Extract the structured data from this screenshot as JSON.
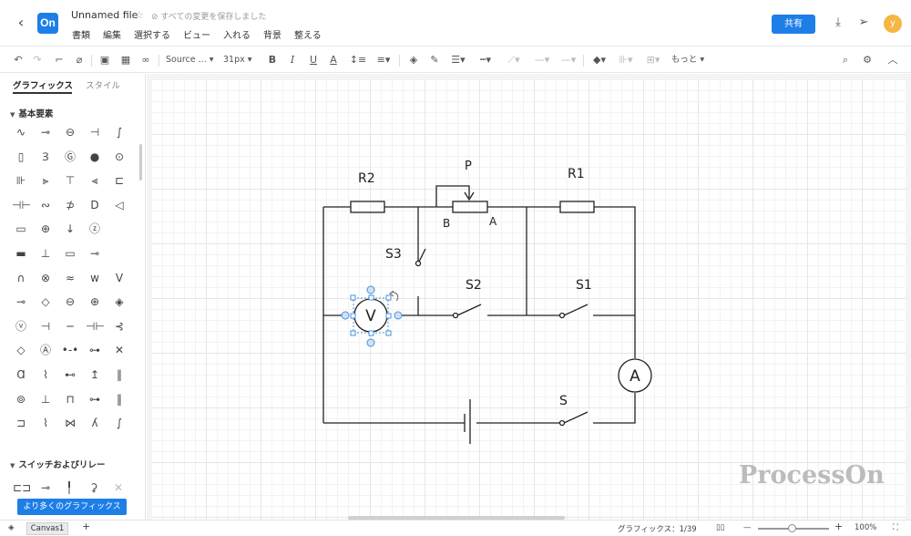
{
  "header": {
    "back": "‹",
    "logo": "On",
    "file_title": "Unnamed file",
    "saved_status": "すべての変更を保存しました",
    "menu": [
      "書類",
      "編集",
      "選択する",
      "ビュー",
      "入れる",
      "背景",
      "整える"
    ],
    "share_label": "共有",
    "avatar": "y"
  },
  "toolbar": {
    "font_name": "Source ...",
    "font_size": "31px",
    "more": "もっと"
  },
  "sidebar": {
    "tabs": [
      "グラフィックス",
      "スタイル"
    ],
    "section_basic": "基本要素",
    "section_switch": "スイッチおよびリレー",
    "more_shapes": "より多くのグラフィックス"
  },
  "circuit": {
    "labels": {
      "R2": "R2",
      "R1": "R1",
      "P": "P",
      "B": "B",
      "A_pot": "A",
      "S3": "S3",
      "S2": "S2",
      "S1": "S1",
      "S": "S",
      "V": "V",
      "A_meter": "A"
    }
  },
  "watermark": "ProcessOn",
  "statusbar": {
    "canvas_tab": "Canvas1",
    "add": "+",
    "graphics_count": "グラフィックス：1/39",
    "zoom_minus": "—",
    "zoom_plus": "+",
    "zoom_level": "100%"
  },
  "colors": {
    "accent": "#1e7ee8",
    "avatar": "#f5b642",
    "selection": "#4a90d9"
  }
}
